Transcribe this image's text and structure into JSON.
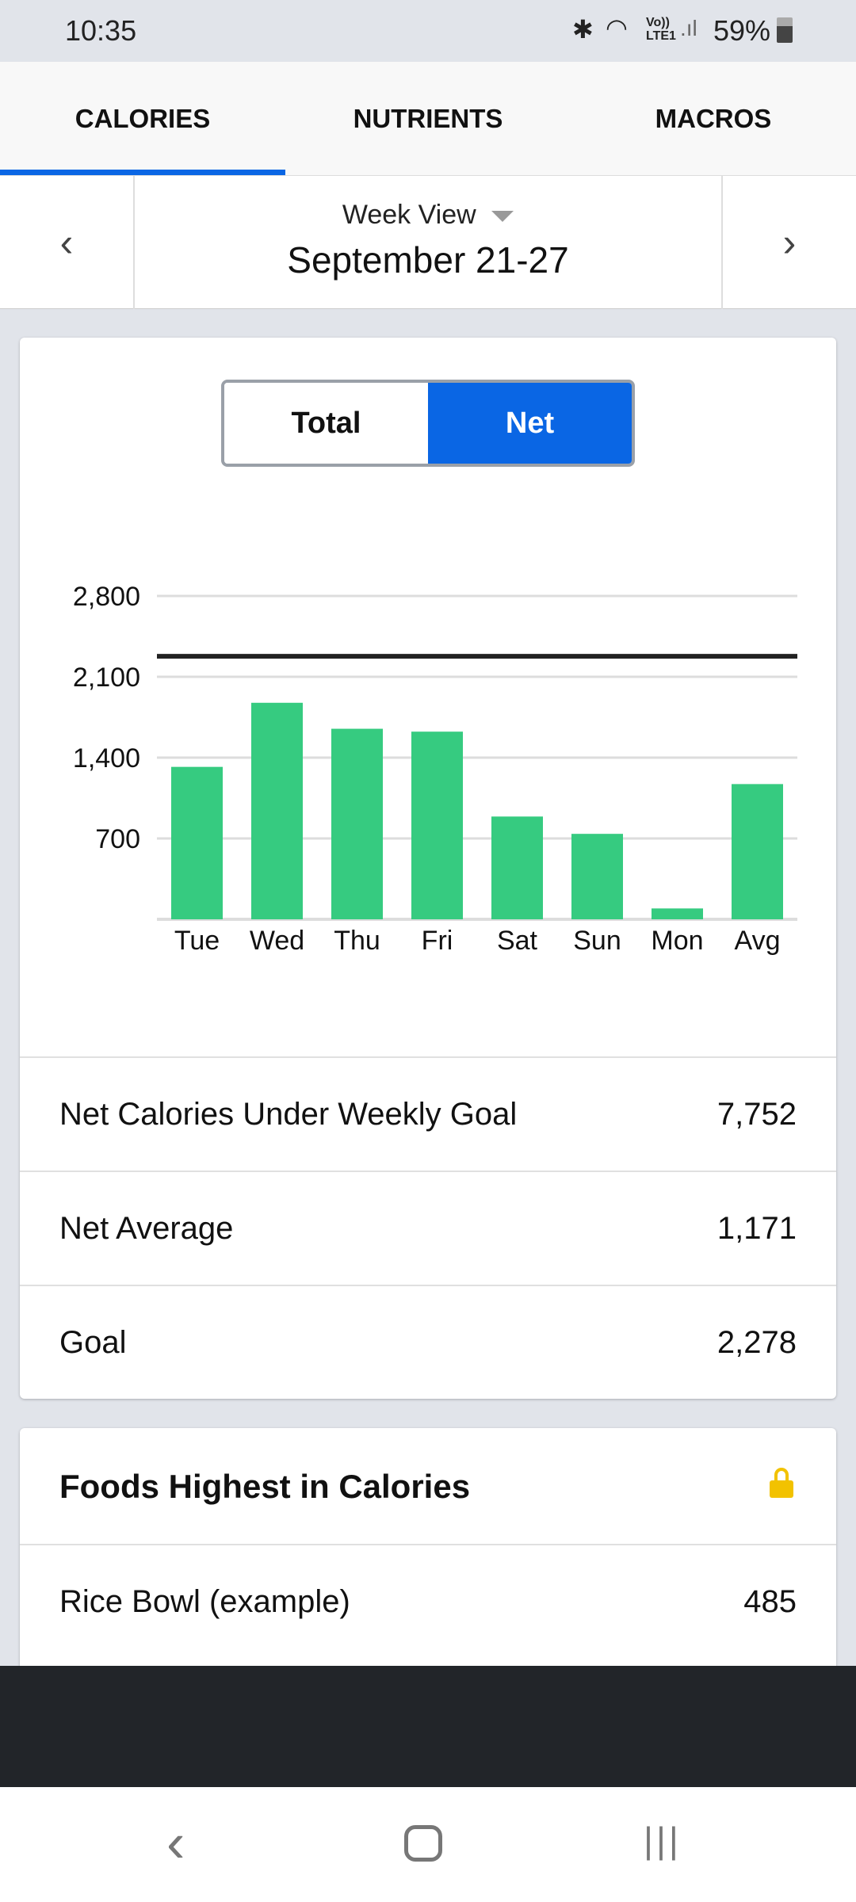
{
  "status": {
    "time": "10:35",
    "volte": "Vo)) LTE1",
    "battery": "59%"
  },
  "tabs": [
    {
      "label": "CALORIES",
      "active": true
    },
    {
      "label": "NUTRIENTS"
    },
    {
      "label": "MACROS"
    }
  ],
  "date_nav": {
    "view": "Week View",
    "range": "September 21-27"
  },
  "toggle": {
    "total": "Total",
    "net": "Net",
    "selected": "Net"
  },
  "colors": {
    "accent": "#0a66e4",
    "bar": "#36cb80",
    "goal_line": "#222222"
  },
  "chart_data": {
    "type": "bar",
    "categories": [
      "Tue",
      "Wed",
      "Thu",
      "Fri",
      "Sat",
      "Sun",
      "Mon",
      "Avg"
    ],
    "values": [
      1320,
      1875,
      1650,
      1625,
      890,
      740,
      94,
      1171
    ],
    "goal_line": 2278,
    "ylim": [
      0,
      2800
    ],
    "yticks": [
      "700",
      "1,400",
      "2,100",
      "2,800"
    ],
    "ytick_values": [
      700,
      1400,
      2100,
      2800
    ],
    "grid": true
  },
  "stats": [
    {
      "label": "Net Calories Under Weekly Goal",
      "value": "7,752"
    },
    {
      "label": "Net Average",
      "value": "1,171"
    },
    {
      "label": "Goal",
      "value": "2,278"
    }
  ],
  "foods": {
    "title": "Foods Highest in Calories",
    "items": [
      {
        "name": "Rice Bowl (example)",
        "value": "485"
      }
    ]
  }
}
